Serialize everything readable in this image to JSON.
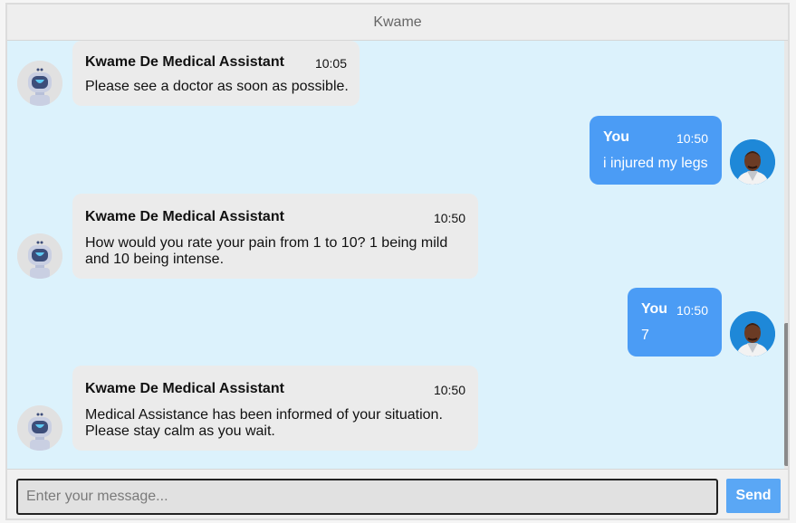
{
  "header": {
    "title": "Kwame"
  },
  "messages": [
    {
      "role": "bot",
      "sender": "Kwame De Medical Assistant",
      "time": "10:05",
      "text_lines": [
        "Please see a doctor as soon as possible."
      ]
    },
    {
      "role": "user",
      "sender": "You",
      "time": "10:50",
      "text_lines": [
        "i injured my legs"
      ]
    },
    {
      "role": "bot",
      "sender": "Kwame De Medical Assistant",
      "time": "10:50",
      "text_lines": [
        "How would you rate your pain from 1 to 10? 1 being mild",
        "and 10 being intense."
      ]
    },
    {
      "role": "user",
      "sender": "You",
      "time": "10:50",
      "text_lines": [
        "7"
      ]
    },
    {
      "role": "bot",
      "sender": "Kwame De Medical Assistant",
      "time": "10:50",
      "text_lines": [
        "Medical Assistance has been informed of your situation.",
        "Please stay calm as you wait."
      ]
    }
  ],
  "icons": {
    "bot_avatar": "robot-icon",
    "user_avatar": "user-photo-avatar"
  },
  "input": {
    "placeholder": "Enter your message...",
    "value": ""
  },
  "send_button": {
    "label": "Send"
  },
  "colors": {
    "chat_background": "#dcf2fc",
    "bot_bubble": "#ebebeb",
    "user_bubble": "#4b9cf5",
    "send_button": "#5aa7f5"
  }
}
